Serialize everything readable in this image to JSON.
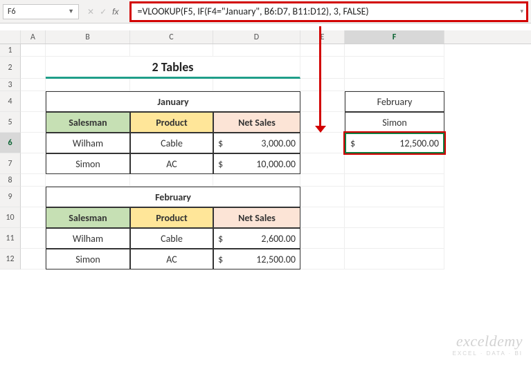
{
  "namebox": {
    "value": "F6"
  },
  "formula_bar": {
    "text": "=VLOOKUP(F5, IF(F4=\"January\", B6:D7, B11:D12), 3, FALSE)"
  },
  "columns": [
    "",
    "A",
    "B",
    "C",
    "D",
    "E",
    "F"
  ],
  "selected_col": "F",
  "row_labels": [
    "1",
    "2",
    "3",
    "4",
    "5",
    "6",
    "7",
    "8",
    "9",
    "10",
    "11",
    "12"
  ],
  "selected_row": "6",
  "page_title": "2 Tables",
  "tables": {
    "jan": {
      "title": "January",
      "headers": {
        "salesman": "Salesman",
        "product": "Product",
        "netsales": "Net Sales"
      },
      "rows": [
        {
          "salesman": "Wilham",
          "product": "Cable",
          "netsales": "3,000.00"
        },
        {
          "salesman": "Simon",
          "product": "AC",
          "netsales": "10,000.00"
        }
      ]
    },
    "feb": {
      "title": "February",
      "headers": {
        "salesman": "Salesman",
        "product": "Product",
        "netsales": "Net Sales"
      },
      "rows": [
        {
          "salesman": "Wilham",
          "product": "Cable",
          "netsales": "2,600.00"
        },
        {
          "salesman": "Simon",
          "product": "AC",
          "netsales": "12,500.00"
        }
      ]
    }
  },
  "lookup_panel": {
    "month": "February",
    "salesman": "Simon",
    "result": "12,500.00"
  },
  "currency_symbol": "$",
  "watermark": {
    "brand": "exceldemy",
    "tag": "EXCEL · DATA · BI"
  }
}
